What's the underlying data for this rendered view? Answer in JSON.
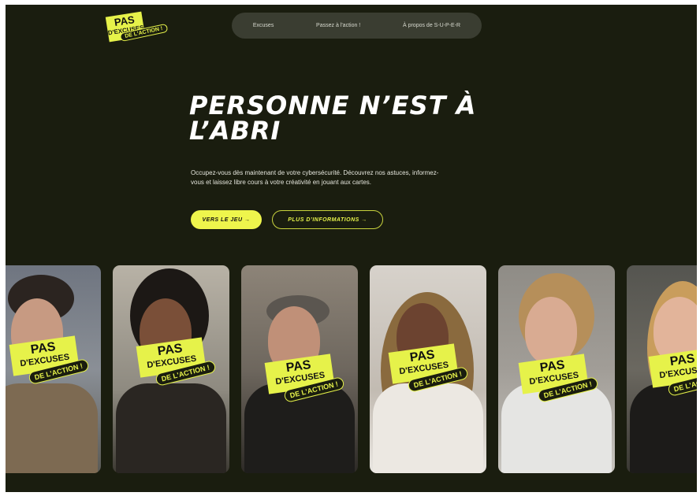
{
  "logo": {
    "line1": "PAS",
    "line2": "D'EXCUSES",
    "line3": "DE L'ACTION !"
  },
  "nav": {
    "items": [
      "Excuses",
      "Passez à l'action !",
      "À propos de S-U-P-E-R"
    ]
  },
  "hero": {
    "title": "PERSONNE N’EST À L’ABRI",
    "description": "Occupez-vous dès maintenant de votre cybersécurité. Découvrez nos astuces, informez-vous et laissez libre cours à votre créativité en jouant aux cartes.",
    "primary_button": "VERS LE JEU →",
    "secondary_button": "PLUS D’INFORMATIONS →"
  },
  "sticker": {
    "line1": "PAS",
    "line2": "D'EXCUSES",
    "line3": "DE L'ACTION !"
  },
  "colors": {
    "background": "#1a1d0f",
    "accent": "#e6f24a",
    "nav_bg": "#3a3d31"
  }
}
